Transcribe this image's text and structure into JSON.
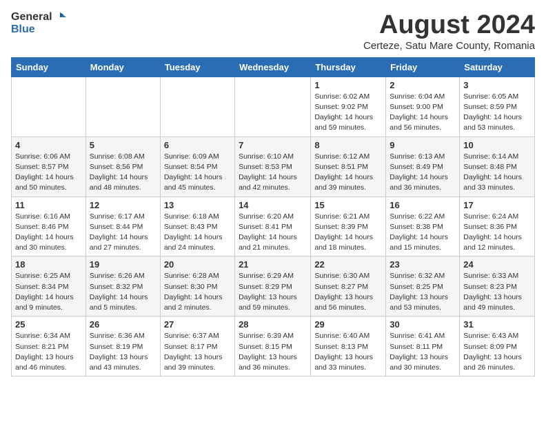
{
  "logo": {
    "general": "General",
    "blue": "Blue"
  },
  "title": "August 2024",
  "subtitle": "Certeze, Satu Mare County, Romania",
  "days_header": [
    "Sunday",
    "Monday",
    "Tuesday",
    "Wednesday",
    "Thursday",
    "Friday",
    "Saturday"
  ],
  "weeks": [
    [
      {
        "day": "",
        "info": ""
      },
      {
        "day": "",
        "info": ""
      },
      {
        "day": "",
        "info": ""
      },
      {
        "day": "",
        "info": ""
      },
      {
        "day": "1",
        "info": "Sunrise: 6:02 AM\nSunset: 9:02 PM\nDaylight: 14 hours\nand 59 minutes."
      },
      {
        "day": "2",
        "info": "Sunrise: 6:04 AM\nSunset: 9:00 PM\nDaylight: 14 hours\nand 56 minutes."
      },
      {
        "day": "3",
        "info": "Sunrise: 6:05 AM\nSunset: 8:59 PM\nDaylight: 14 hours\nand 53 minutes."
      }
    ],
    [
      {
        "day": "4",
        "info": "Sunrise: 6:06 AM\nSunset: 8:57 PM\nDaylight: 14 hours\nand 50 minutes."
      },
      {
        "day": "5",
        "info": "Sunrise: 6:08 AM\nSunset: 8:56 PM\nDaylight: 14 hours\nand 48 minutes."
      },
      {
        "day": "6",
        "info": "Sunrise: 6:09 AM\nSunset: 8:54 PM\nDaylight: 14 hours\nand 45 minutes."
      },
      {
        "day": "7",
        "info": "Sunrise: 6:10 AM\nSunset: 8:53 PM\nDaylight: 14 hours\nand 42 minutes."
      },
      {
        "day": "8",
        "info": "Sunrise: 6:12 AM\nSunset: 8:51 PM\nDaylight: 14 hours\nand 39 minutes."
      },
      {
        "day": "9",
        "info": "Sunrise: 6:13 AM\nSunset: 8:49 PM\nDaylight: 14 hours\nand 36 minutes."
      },
      {
        "day": "10",
        "info": "Sunrise: 6:14 AM\nSunset: 8:48 PM\nDaylight: 14 hours\nand 33 minutes."
      }
    ],
    [
      {
        "day": "11",
        "info": "Sunrise: 6:16 AM\nSunset: 8:46 PM\nDaylight: 14 hours\nand 30 minutes."
      },
      {
        "day": "12",
        "info": "Sunrise: 6:17 AM\nSunset: 8:44 PM\nDaylight: 14 hours\nand 27 minutes."
      },
      {
        "day": "13",
        "info": "Sunrise: 6:18 AM\nSunset: 8:43 PM\nDaylight: 14 hours\nand 24 minutes."
      },
      {
        "day": "14",
        "info": "Sunrise: 6:20 AM\nSunset: 8:41 PM\nDaylight: 14 hours\nand 21 minutes."
      },
      {
        "day": "15",
        "info": "Sunrise: 6:21 AM\nSunset: 8:39 PM\nDaylight: 14 hours\nand 18 minutes."
      },
      {
        "day": "16",
        "info": "Sunrise: 6:22 AM\nSunset: 8:38 PM\nDaylight: 14 hours\nand 15 minutes."
      },
      {
        "day": "17",
        "info": "Sunrise: 6:24 AM\nSunset: 8:36 PM\nDaylight: 14 hours\nand 12 minutes."
      }
    ],
    [
      {
        "day": "18",
        "info": "Sunrise: 6:25 AM\nSunset: 8:34 PM\nDaylight: 14 hours\nand 9 minutes."
      },
      {
        "day": "19",
        "info": "Sunrise: 6:26 AM\nSunset: 8:32 PM\nDaylight: 14 hours\nand 5 minutes."
      },
      {
        "day": "20",
        "info": "Sunrise: 6:28 AM\nSunset: 8:30 PM\nDaylight: 14 hours\nand 2 minutes."
      },
      {
        "day": "21",
        "info": "Sunrise: 6:29 AM\nSunset: 8:29 PM\nDaylight: 13 hours\nand 59 minutes."
      },
      {
        "day": "22",
        "info": "Sunrise: 6:30 AM\nSunset: 8:27 PM\nDaylight: 13 hours\nand 56 minutes."
      },
      {
        "day": "23",
        "info": "Sunrise: 6:32 AM\nSunset: 8:25 PM\nDaylight: 13 hours\nand 53 minutes."
      },
      {
        "day": "24",
        "info": "Sunrise: 6:33 AM\nSunset: 8:23 PM\nDaylight: 13 hours\nand 49 minutes."
      }
    ],
    [
      {
        "day": "25",
        "info": "Sunrise: 6:34 AM\nSunset: 8:21 PM\nDaylight: 13 hours\nand 46 minutes."
      },
      {
        "day": "26",
        "info": "Sunrise: 6:36 AM\nSunset: 8:19 PM\nDaylight: 13 hours\nand 43 minutes."
      },
      {
        "day": "27",
        "info": "Sunrise: 6:37 AM\nSunset: 8:17 PM\nDaylight: 13 hours\nand 39 minutes."
      },
      {
        "day": "28",
        "info": "Sunrise: 6:39 AM\nSunset: 8:15 PM\nDaylight: 13 hours\nand 36 minutes."
      },
      {
        "day": "29",
        "info": "Sunrise: 6:40 AM\nSunset: 8:13 PM\nDaylight: 13 hours\nand 33 minutes."
      },
      {
        "day": "30",
        "info": "Sunrise: 6:41 AM\nSunset: 8:11 PM\nDaylight: 13 hours\nand 30 minutes."
      },
      {
        "day": "31",
        "info": "Sunrise: 6:43 AM\nSunset: 8:09 PM\nDaylight: 13 hours\nand 26 minutes."
      }
    ]
  ]
}
